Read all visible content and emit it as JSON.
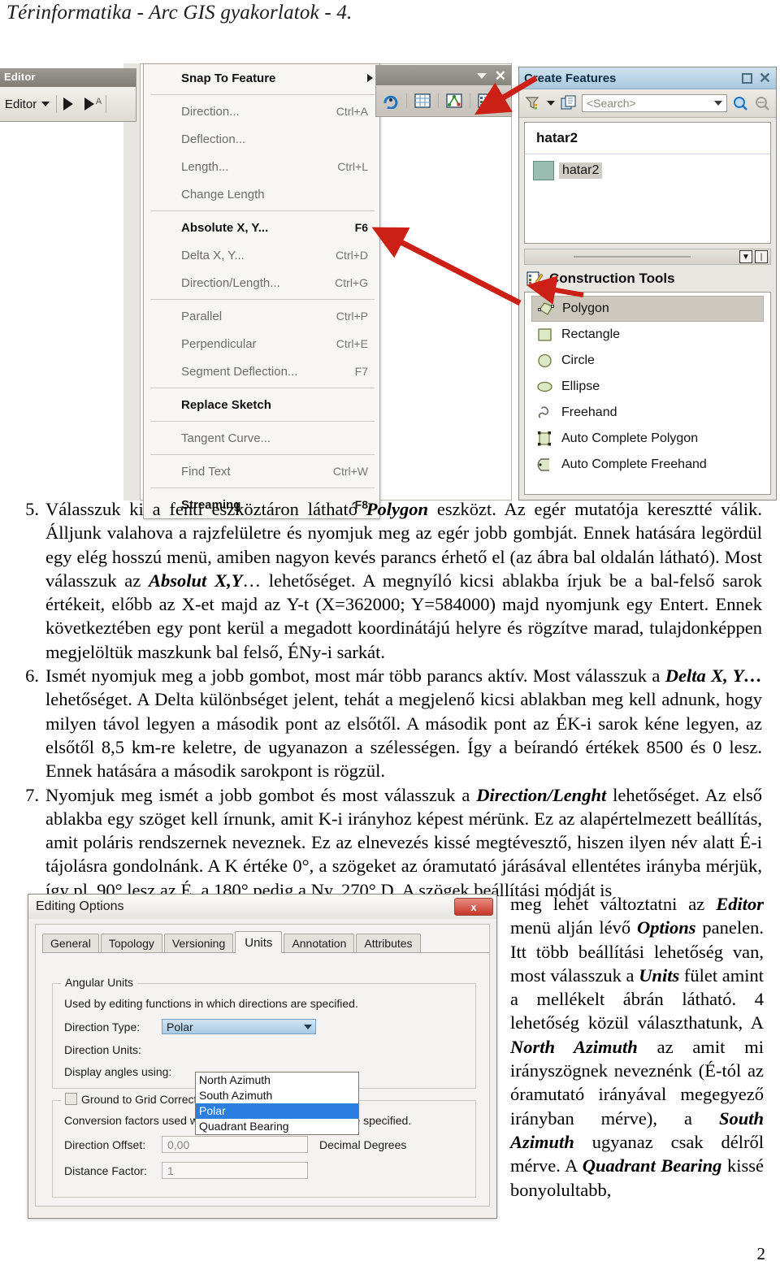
{
  "document": {
    "header": "Térinformatika - Arc GIS gyakorlatok - 4.",
    "page_number": "2"
  },
  "figure_editor_toolbar": {
    "window_title": "Editor",
    "menu_button": "Editor",
    "icons": [
      "editor-dropdown-caret",
      "edit-tool-pointer-icon",
      "edit-annotation-pointer-icon"
    ]
  },
  "figure_context_menu": {
    "items": [
      {
        "label": "Snap To Feature",
        "shortcut": "",
        "enabled": true,
        "submenu": true
      },
      {
        "separator": true
      },
      {
        "label": "Direction...",
        "shortcut": "Ctrl+A",
        "enabled": false
      },
      {
        "label": "Deflection...",
        "shortcut": "",
        "enabled": false
      },
      {
        "label": "Length...",
        "shortcut": "Ctrl+L",
        "enabled": false
      },
      {
        "label": "Change Length",
        "shortcut": "",
        "enabled": false
      },
      {
        "separator": true
      },
      {
        "label": "Absolute X, Y...",
        "shortcut": "F6",
        "enabled": true
      },
      {
        "label": "Delta X, Y...",
        "shortcut": "Ctrl+D",
        "enabled": false
      },
      {
        "label": "Direction/Length...",
        "shortcut": "Ctrl+G",
        "enabled": false
      },
      {
        "separator": true
      },
      {
        "label": "Parallel",
        "shortcut": "Ctrl+P",
        "enabled": false
      },
      {
        "label": "Perpendicular",
        "shortcut": "Ctrl+E",
        "enabled": false
      },
      {
        "label": "Segment Deflection...",
        "shortcut": "F7",
        "enabled": false
      },
      {
        "separator": true
      },
      {
        "label": "Replace Sketch",
        "shortcut": "",
        "enabled": true
      },
      {
        "separator": true
      },
      {
        "label": "Tangent Curve...",
        "shortcut": "",
        "enabled": false
      },
      {
        "separator": true
      },
      {
        "label": "Find Text",
        "shortcut": "Ctrl+W",
        "enabled": false
      },
      {
        "separator": true
      },
      {
        "label": "Streaming",
        "shortcut": "F8",
        "enabled": true
      }
    ]
  },
  "figure_mini_toolbar": {
    "icons": [
      "undo-icon",
      "table-icon",
      "graph-icon",
      "attributes-icon"
    ]
  },
  "figure_create_features": {
    "title": "Create Features",
    "search_placeholder": "<Search>",
    "toolbar_icons": [
      "filter-icon",
      "organize-templates-icon",
      "search-icon",
      "find-icon"
    ],
    "layer_group": "hatar2",
    "template": "hatar2",
    "template_swatch_color": "#9bbcb0",
    "section_title": "Construction Tools",
    "tools": [
      {
        "label": "Polygon",
        "icon": "polygon-icon",
        "selected": true
      },
      {
        "label": "Rectangle",
        "icon": "rectangle-icon",
        "selected": false
      },
      {
        "label": "Circle",
        "icon": "circle-icon",
        "selected": false
      },
      {
        "label": "Ellipse",
        "icon": "ellipse-icon",
        "selected": false
      },
      {
        "label": "Freehand",
        "icon": "freehand-icon",
        "selected": false
      },
      {
        "label": "Auto Complete Polygon",
        "icon": "auto-complete-polygon-icon",
        "selected": false
      },
      {
        "label": "Auto Complete Freehand",
        "icon": "auto-complete-freehand-icon",
        "selected": false
      }
    ],
    "annotation_arrow_color": "#cc1f16"
  },
  "body": {
    "item5": {
      "number": "5.",
      "p1a": "Válasszuk ki a fenti eszköztáron látható ",
      "b1": "Polygon",
      "p1b": " eszközt. Az egér mutatója keresztté válik. Álljunk valahova a rajzfelületre és nyomjuk meg az egér jobb gombját. Ennek hatására legördül egy elég hosszú menü, amiben nagyon kevés parancs érhető el (az ábra bal oldalán látható). Most válasszuk az ",
      "b2": "Absolut X,Y",
      "p1c": "… lehetőséget. A megnyíló kicsi ablakba írjuk be a bal-felső sarok értékeit, előbb az X-et majd az Y-t (X=362000; Y=584000) majd nyomjunk egy Entert. Ennek következtében egy pont kerül a megadott koordinátájú helyre és rögzítve marad, tulajdonképpen megjelöltük maszkunk bal felső, ÉNy-i sarkát."
    },
    "item6": {
      "number": "6.",
      "p1a": "Ismét nyomjuk meg a jobb gombot, most már több parancs aktív. Most válasszuk a ",
      "b1": "Delta X, Y…",
      "p1b": " lehetőséget. A Delta különbséget jelent, tehát a megjelenő kicsi ablakban meg kell adnunk, hogy milyen távol legyen a második pont az elsőtől.  A második pont az ÉK-i sarok kéne legyen, az elsőtől 8,5 km-re keletre, de ugyanazon a szélességen. Így a beírandó értékek 8500 és 0 lesz. Ennek hatására a második sarokpont is rögzül."
    },
    "item7": {
      "number": "7.",
      "p1a": "Nyomjuk meg ismét a jobb gombot és most válasszuk a ",
      "b1": "Direction/Lenght",
      "p1b": " lehetőséget. Az első ablakba egy szöget kell írnunk, amit K-i irányhoz képest mérünk. Ez az alapértelmezett beállítás, amit poláris rendszernek neveznek. Ez az elnevezés kissé megtévesztő, hiszen ilyen név alatt É-i tájolásra gondolnánk. A K értéke 0°, a szögeket az óramutató járásával ellentétes irányba mérjük, így pl. 90° lesz az É, a 180° pedig a Ny, 270° D. A szögek beállítási módját is "
    },
    "right_column": {
      "t1": "meg lehet változtatni az ",
      "b1": "Editor",
      "t2": " menü alján lévő ",
      "b2": "Options",
      "t3": " panelen. Itt több beállítási lehetőség van, most válasszuk a ",
      "b3": "Units",
      "t4": " fület amint a mellékelt ábrán látható. 4 lehetőség közül választhatunk, A ",
      "b4": "North Azimuth",
      "t5": " az amit mi irányszögnek neveznénk (É-tól az óramutató irányával megegyező irányban mérve), a ",
      "b5": "South Azimuth",
      "t6": " ugyanaz csak délről mérve. A ",
      "b6": "Quadrant Bearing",
      "t7": " kissé bonyolultabb,"
    }
  },
  "figure_editing_options": {
    "title": "Editing Options",
    "close_label": "x",
    "tabs": [
      {
        "label": "General",
        "active": false
      },
      {
        "label": "Topology",
        "active": false
      },
      {
        "label": "Versioning",
        "active": false
      },
      {
        "label": "Units",
        "active": true
      },
      {
        "label": "Annotation",
        "active": false
      },
      {
        "label": "Attributes",
        "active": false
      }
    ],
    "angular_units": {
      "legend": "Angular Units",
      "hint": "Used by editing functions in which directions are specified.",
      "direction_type_label": "Direction Type:",
      "direction_type_value": "Polar",
      "direction_units_label": "Direction Units:",
      "display_angles_label": "Display angles using:",
      "dropdown_options": [
        {
          "label": "North Azimuth",
          "selected": false
        },
        {
          "label": "South Azimuth",
          "selected": false
        },
        {
          "label": "Polar",
          "selected": true
        },
        {
          "label": "Quadrant Bearing",
          "selected": false
        }
      ],
      "dropdown_highlight_color": "#2a7fe0"
    },
    "ground_to_grid": {
      "checkbox_label": "Ground to Grid Correction",
      "checked": false,
      "hint": "Conversion factors used where distance and directions are specified.",
      "direction_offset_label": "Direction Offset:",
      "direction_offset_value": "0,00",
      "direction_offset_unit": "Decimal Degrees",
      "distance_factor_label": "Distance Factor:",
      "distance_factor_value": "1"
    }
  }
}
